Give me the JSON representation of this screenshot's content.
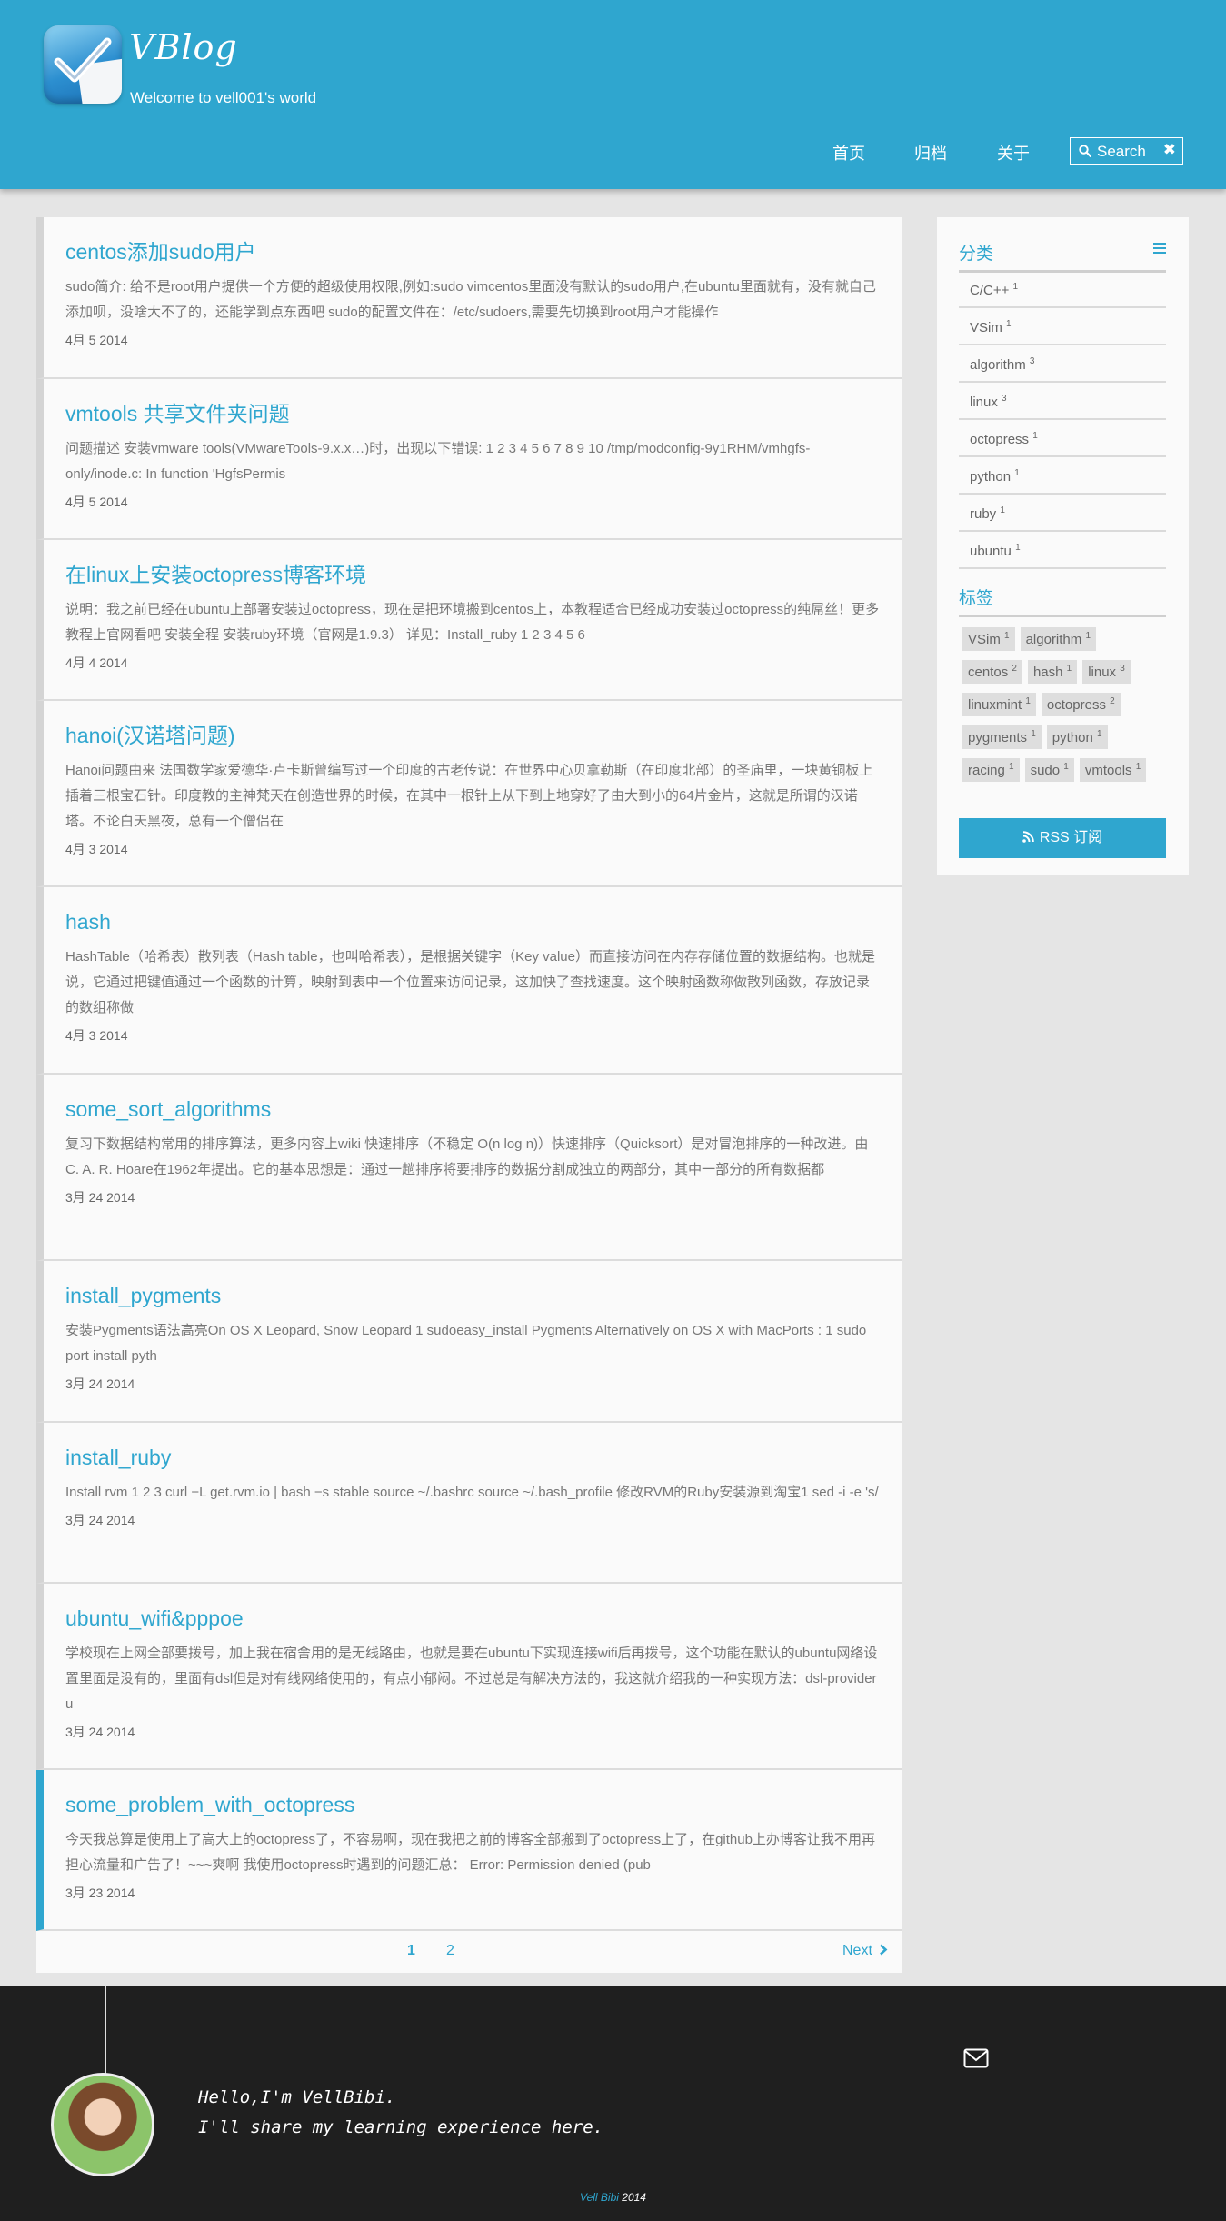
{
  "header": {
    "title": "VBlog",
    "subtitle": "Welcome to vell001's world",
    "nav": {
      "home": "首页",
      "archive": "归档",
      "about": "关于"
    },
    "search_label": "Search",
    "brand_color": "#2fa6cf"
  },
  "posts": [
    {
      "title": "centos添加sudo用户",
      "excerpt": "sudo简介: 给不是root用户提供一个方便的超级使用权限,例如:sudo vimcentos里面没有默认的sudo用户,在ubuntu里面就有，没有就自己添加呗，没啥大不了的，还能学到点东西吧 sudo的配置文件在：/etc/sudoers,需要先切换到root用户才能操作",
      "date": "4月 5 2014"
    },
    {
      "title": "vmtools 共享文件夹问题",
      "excerpt": "问题描述 安装vmware tools(VMwareTools-9.x.x…)时，出现以下错误: 1 2 3 4 5 6 7 8 9 10 /tmp/modconfig-9y1RHM/vmhgfs-only/inode.c: In function 'HgfsPermis",
      "date": "4月 5 2014"
    },
    {
      "title": "在linux上安装octopress博客环境",
      "excerpt": "说明：我之前已经在ubuntu上部署安装过octopress，现在是把环境搬到centos上，本教程适合已经成功安装过octopress的纯屌丝！更多教程上官网看吧 安装全程 安装ruby环境（官网是1.9.3） 详见：Install_ruby 1 2 3 4 5 6",
      "date": "4月 4 2014"
    },
    {
      "title": "hanoi(汉诺塔问题)",
      "excerpt": "Hanoi问题由来 法国数学家爱德华·卢卡斯曾编写过一个印度的古老传说：在世界中心贝拿勒斯（在印度北部）的圣庙里，一块黄铜板上插着三根宝石针。印度教的主神梵天在创造世界的时候，在其中一根针上从下到上地穿好了由大到小的64片金片，这就是所谓的汉诺塔。不论白天黑夜，总有一个僧侣在",
      "date": "4月 3 2014"
    },
    {
      "title": "hash",
      "excerpt": "HashTable（哈希表）散列表（Hash table，也叫哈希表），是根据关键字（Key value）而直接访问在内存存储位置的数据结构。也就是说，它通过把键值通过一个函数的计算，映射到表中一个位置来访问记录，这加快了查找速度。这个映射函数称做散列函数，存放记录的数组称做",
      "date": "4月 3 2014"
    },
    {
      "title": "some_sort_algorithms",
      "excerpt": "复习下数据结构常用的排序算法，更多内容上wiki 快速排序（不稳定 O(n log n)）快速排序（Quicksort）是对冒泡排序的一种改进。由C. A. R. Hoare在1962年提出。它的基本思想是：通过一趟排序将要排序的数据分割成独立的两部分，其中一部分的所有数据都",
      "date": "3月 24 2014"
    },
    {
      "title": "install_pygments",
      "excerpt": "安装Pygments语法高亮On OS X Leopard, Snow Leopard 1 sudoeasy_install Pygments Alternatively on OS X with MacPorts : 1 sudo port install pyth",
      "date": "3月 24 2014"
    },
    {
      "title": "install_ruby",
      "excerpt": "Install rvm 1 2 3 curl −L get.rvm.io | bash −s stable source ~/.bashrc source ~/.bash_profile 修改RVM的Ruby安装源到淘宝1 sed -i -e 's/",
      "date": "3月 24 2014"
    },
    {
      "title": "ubuntu_wifi&pppoe",
      "excerpt": "学校现在上网全部要拨号，加上我在宿舍用的是无线路由，也就是要在ubuntu下实现连接wifi后再拨号，这个功能在默认的ubuntu网络设置里面是没有的，里面有dsl但是对有线网络使用的，有点小郁闷。不过总是有解决方法的，我这就介绍我的一种实现方法：dsl-provider u",
      "date": "3月 24 2014"
    },
    {
      "title": "some_problem_with_octopress",
      "excerpt": "今天我总算是使用上了高大上的octopress了，不容易啊，现在我把之前的博客全部搬到了octopress上了，在github上办博客让我不用再担心流量和广告了！~~~爽啊 我使用octopress时遇到的问题汇总： Error: Permission denied (pub",
      "date": "3月 23 2014"
    }
  ],
  "pagination": {
    "page1": "1",
    "page2": "2",
    "next": "Next"
  },
  "sidebar": {
    "categories_heading": "分类",
    "categories": [
      {
        "name": "C/C++",
        "count": "1"
      },
      {
        "name": "VSim",
        "count": "1"
      },
      {
        "name": "algorithm",
        "count": "3"
      },
      {
        "name": "linux",
        "count": "3"
      },
      {
        "name": "octopress",
        "count": "1"
      },
      {
        "name": "python",
        "count": "1"
      },
      {
        "name": "ruby",
        "count": "1"
      },
      {
        "name": "ubuntu",
        "count": "1"
      }
    ],
    "tags_heading": "标签",
    "tags": [
      {
        "name": "VSim",
        "count": "1"
      },
      {
        "name": "algorithm",
        "count": "1"
      },
      {
        "name": "centos",
        "count": "2"
      },
      {
        "name": "hash",
        "count": "1"
      },
      {
        "name": "linux",
        "count": "3"
      },
      {
        "name": "linuxmint",
        "count": "1"
      },
      {
        "name": "octopress",
        "count": "2"
      },
      {
        "name": "pygments",
        "count": "1"
      },
      {
        "name": "python",
        "count": "1"
      },
      {
        "name": "racing",
        "count": "1"
      },
      {
        "name": "sudo",
        "count": "1"
      },
      {
        "name": "vmtools",
        "count": "1"
      }
    ],
    "rss_label": "RSS 订阅"
  },
  "footer": {
    "greeting_line1": "Hello,I'm VellBibi.",
    "greeting_line2": "I'll share my learning experience here.",
    "copyright_brand": "Vell Bibi",
    "copyright_year": "2014"
  }
}
